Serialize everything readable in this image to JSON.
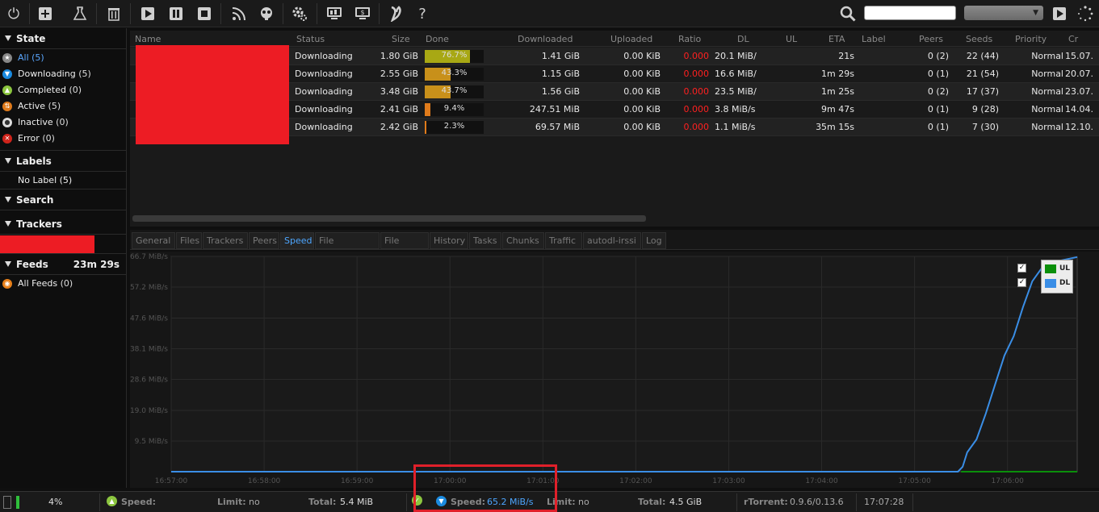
{
  "toolbar": {
    "icons": [
      "power-icon",
      "add-icon",
      "flask-icon",
      "trash-icon",
      "play-icon",
      "pause-icon",
      "stop-icon",
      "rss-icon",
      "plugin-icon",
      "settings-icon",
      "monitor-icon",
      "monitor-alt-icon",
      "logo-icon",
      "help-icon",
      "search-icon",
      "play-small-icon",
      "spinner-icon"
    ],
    "help_label": "?",
    "search_placeholder": "",
    "search_select_value": "▼"
  },
  "sidebar": {
    "state_title": "State",
    "state_items": [
      {
        "label": "All",
        "count": "(5)"
      },
      {
        "label": "Downloading",
        "count": "(5)"
      },
      {
        "label": "Completed",
        "count": "(0)"
      },
      {
        "label": "Active",
        "count": "(5)"
      },
      {
        "label": "Inactive",
        "count": "(0)"
      },
      {
        "label": "Error",
        "count": "(0)"
      }
    ],
    "labels_title": "Labels",
    "labels_items": [
      {
        "label": "No Label (5)"
      }
    ],
    "search_title": "Search",
    "trackers_title": "Trackers",
    "feeds_title": "Feeds",
    "feeds_timer": "23m 29s",
    "feeds_items": [
      {
        "label": "All Feeds",
        "count": "(0)"
      }
    ]
  },
  "list": {
    "columns": [
      "Name",
      "Status",
      "Size",
      "Done",
      "Downloaded",
      "Uploaded",
      "Ratio",
      "DL",
      "UL",
      "ETA",
      "Label",
      "Peers",
      "Seeds",
      "Priority",
      "Cr"
    ],
    "rows": [
      {
        "status": "Downloading",
        "size": "1.80 GiB",
        "done": "76.7%",
        "done_frac": 0.767,
        "downloaded": "1.41 GiB",
        "uploaded": "0.00 KiB",
        "ratio": "0.000",
        "dl": "20.1 MiB/",
        "ul": "",
        "eta": "21s",
        "label": "",
        "peers": "0 (2)",
        "seeds": "22 (44)",
        "priority": "Normal",
        "created": "15.07."
      },
      {
        "status": "Downloading",
        "size": "2.55 GiB",
        "done": "43.3%",
        "done_frac": 0.433,
        "downloaded": "1.15 GiB",
        "uploaded": "0.00 KiB",
        "ratio": "0.000",
        "dl": "16.6 MiB/",
        "ul": "",
        "eta": "1m 29s",
        "label": "",
        "peers": "0 (1)",
        "seeds": "21 (54)",
        "priority": "Normal",
        "created": "20.07."
      },
      {
        "status": "Downloading",
        "size": "3.48 GiB",
        "done": "43.7%",
        "done_frac": 0.437,
        "downloaded": "1.56 GiB",
        "uploaded": "0.00 KiB",
        "ratio": "0.000",
        "dl": "23.5 MiB/",
        "ul": "",
        "eta": "1m 25s",
        "label": "",
        "peers": "0 (2)",
        "seeds": "17 (37)",
        "priority": "Normal",
        "created": "23.07."
      },
      {
        "status": "Downloading",
        "size": "2.41 GiB",
        "done": "9.4%",
        "done_frac": 0.094,
        "downloaded": "247.51 MiB",
        "uploaded": "0.00 KiB",
        "ratio": "0.000",
        "dl": "3.8 MiB/s",
        "ul": "",
        "eta": "9m 47s",
        "label": "",
        "peers": "0 (1)",
        "seeds": "9 (28)",
        "priority": "Normal",
        "created": "14.04."
      },
      {
        "status": "Downloading",
        "size": "2.42 GiB",
        "done": "2.3%",
        "done_frac": 0.023,
        "downloaded": "69.57 MiB",
        "uploaded": "0.00 KiB",
        "ratio": "0.000",
        "dl": "1.1 MiB/s",
        "ul": "",
        "eta": "35m 15s",
        "label": "",
        "peers": "0 (1)",
        "seeds": "7 (30)",
        "priority": "Normal",
        "created": "12.10."
      }
    ]
  },
  "tabs": [
    "General",
    "Files",
    "Trackers",
    "Peers",
    "Speed",
    "File Manager",
    "File Share",
    "History",
    "Tasks",
    "Chunks",
    "Traffic",
    "autodl-irssi",
    "Log"
  ],
  "active_tab": "Speed",
  "chart_data": {
    "type": "line",
    "title": "",
    "xlabel": "",
    "ylabel": "",
    "y_ticks": [
      "66.7 MiB/s",
      "57.2 MiB/s",
      "47.6 MiB/s",
      "38.1 MiB/s",
      "28.6 MiB/s",
      "19.0 MiB/s",
      "9.5 MiB/s"
    ],
    "y_tick_values": [
      66.7,
      57.2,
      47.6,
      38.1,
      28.6,
      19.0,
      9.5
    ],
    "x_ticks": [
      "16:57:00",
      "16:58:00",
      "16:59:00",
      "17:00:00",
      "17:01:00",
      "17:02:00",
      "17:03:00",
      "17:04:00",
      "17:05:00",
      "17:06:00"
    ],
    "x_range": [
      "16:57:00",
      "17:06:45"
    ],
    "ylim": [
      0,
      66.7
    ],
    "grid": true,
    "legend_position": "top-right",
    "series": [
      {
        "name": "UL",
        "color": "#0a8f0a",
        "points": [
          [
            "17:05:30",
            0
          ],
          [
            "17:06:45",
            0
          ]
        ]
      },
      {
        "name": "DL",
        "color": "#3a8ee6",
        "points": [
          [
            "16:57:00",
            0
          ],
          [
            "17:05:28",
            0
          ],
          [
            "17:05:31",
            1.5
          ],
          [
            "17:05:34",
            6
          ],
          [
            "17:05:40",
            10
          ],
          [
            "17:05:46",
            18
          ],
          [
            "17:05:52",
            27
          ],
          [
            "17:05:58",
            36
          ],
          [
            "17:06:04",
            42
          ],
          [
            "17:06:10",
            51
          ],
          [
            "17:06:16",
            59
          ],
          [
            "17:06:22",
            63
          ],
          [
            "17:06:30",
            65
          ],
          [
            "17:06:45",
            66.5
          ]
        ]
      }
    ]
  },
  "status": {
    "cpu_percent": "4%",
    "ul_speed_label": "Speed:",
    "ul_speed_value": "",
    "ul_limit_label": "Limit:",
    "ul_limit_value": "no",
    "ul_total_label": "Total:",
    "ul_total_value": "5.4 MiB",
    "dl_speed_label": "Speed:",
    "dl_speed_value": "65.2 MiB/s",
    "dl_limit_label": "Limit:",
    "dl_limit_value": "no",
    "dl_total_label": "Total:",
    "dl_total_value": "4.5 GiB",
    "rtorrent_label": "rTorrent:",
    "rtorrent_value": "0.9.6/0.13.6",
    "time": "17:07:28"
  }
}
